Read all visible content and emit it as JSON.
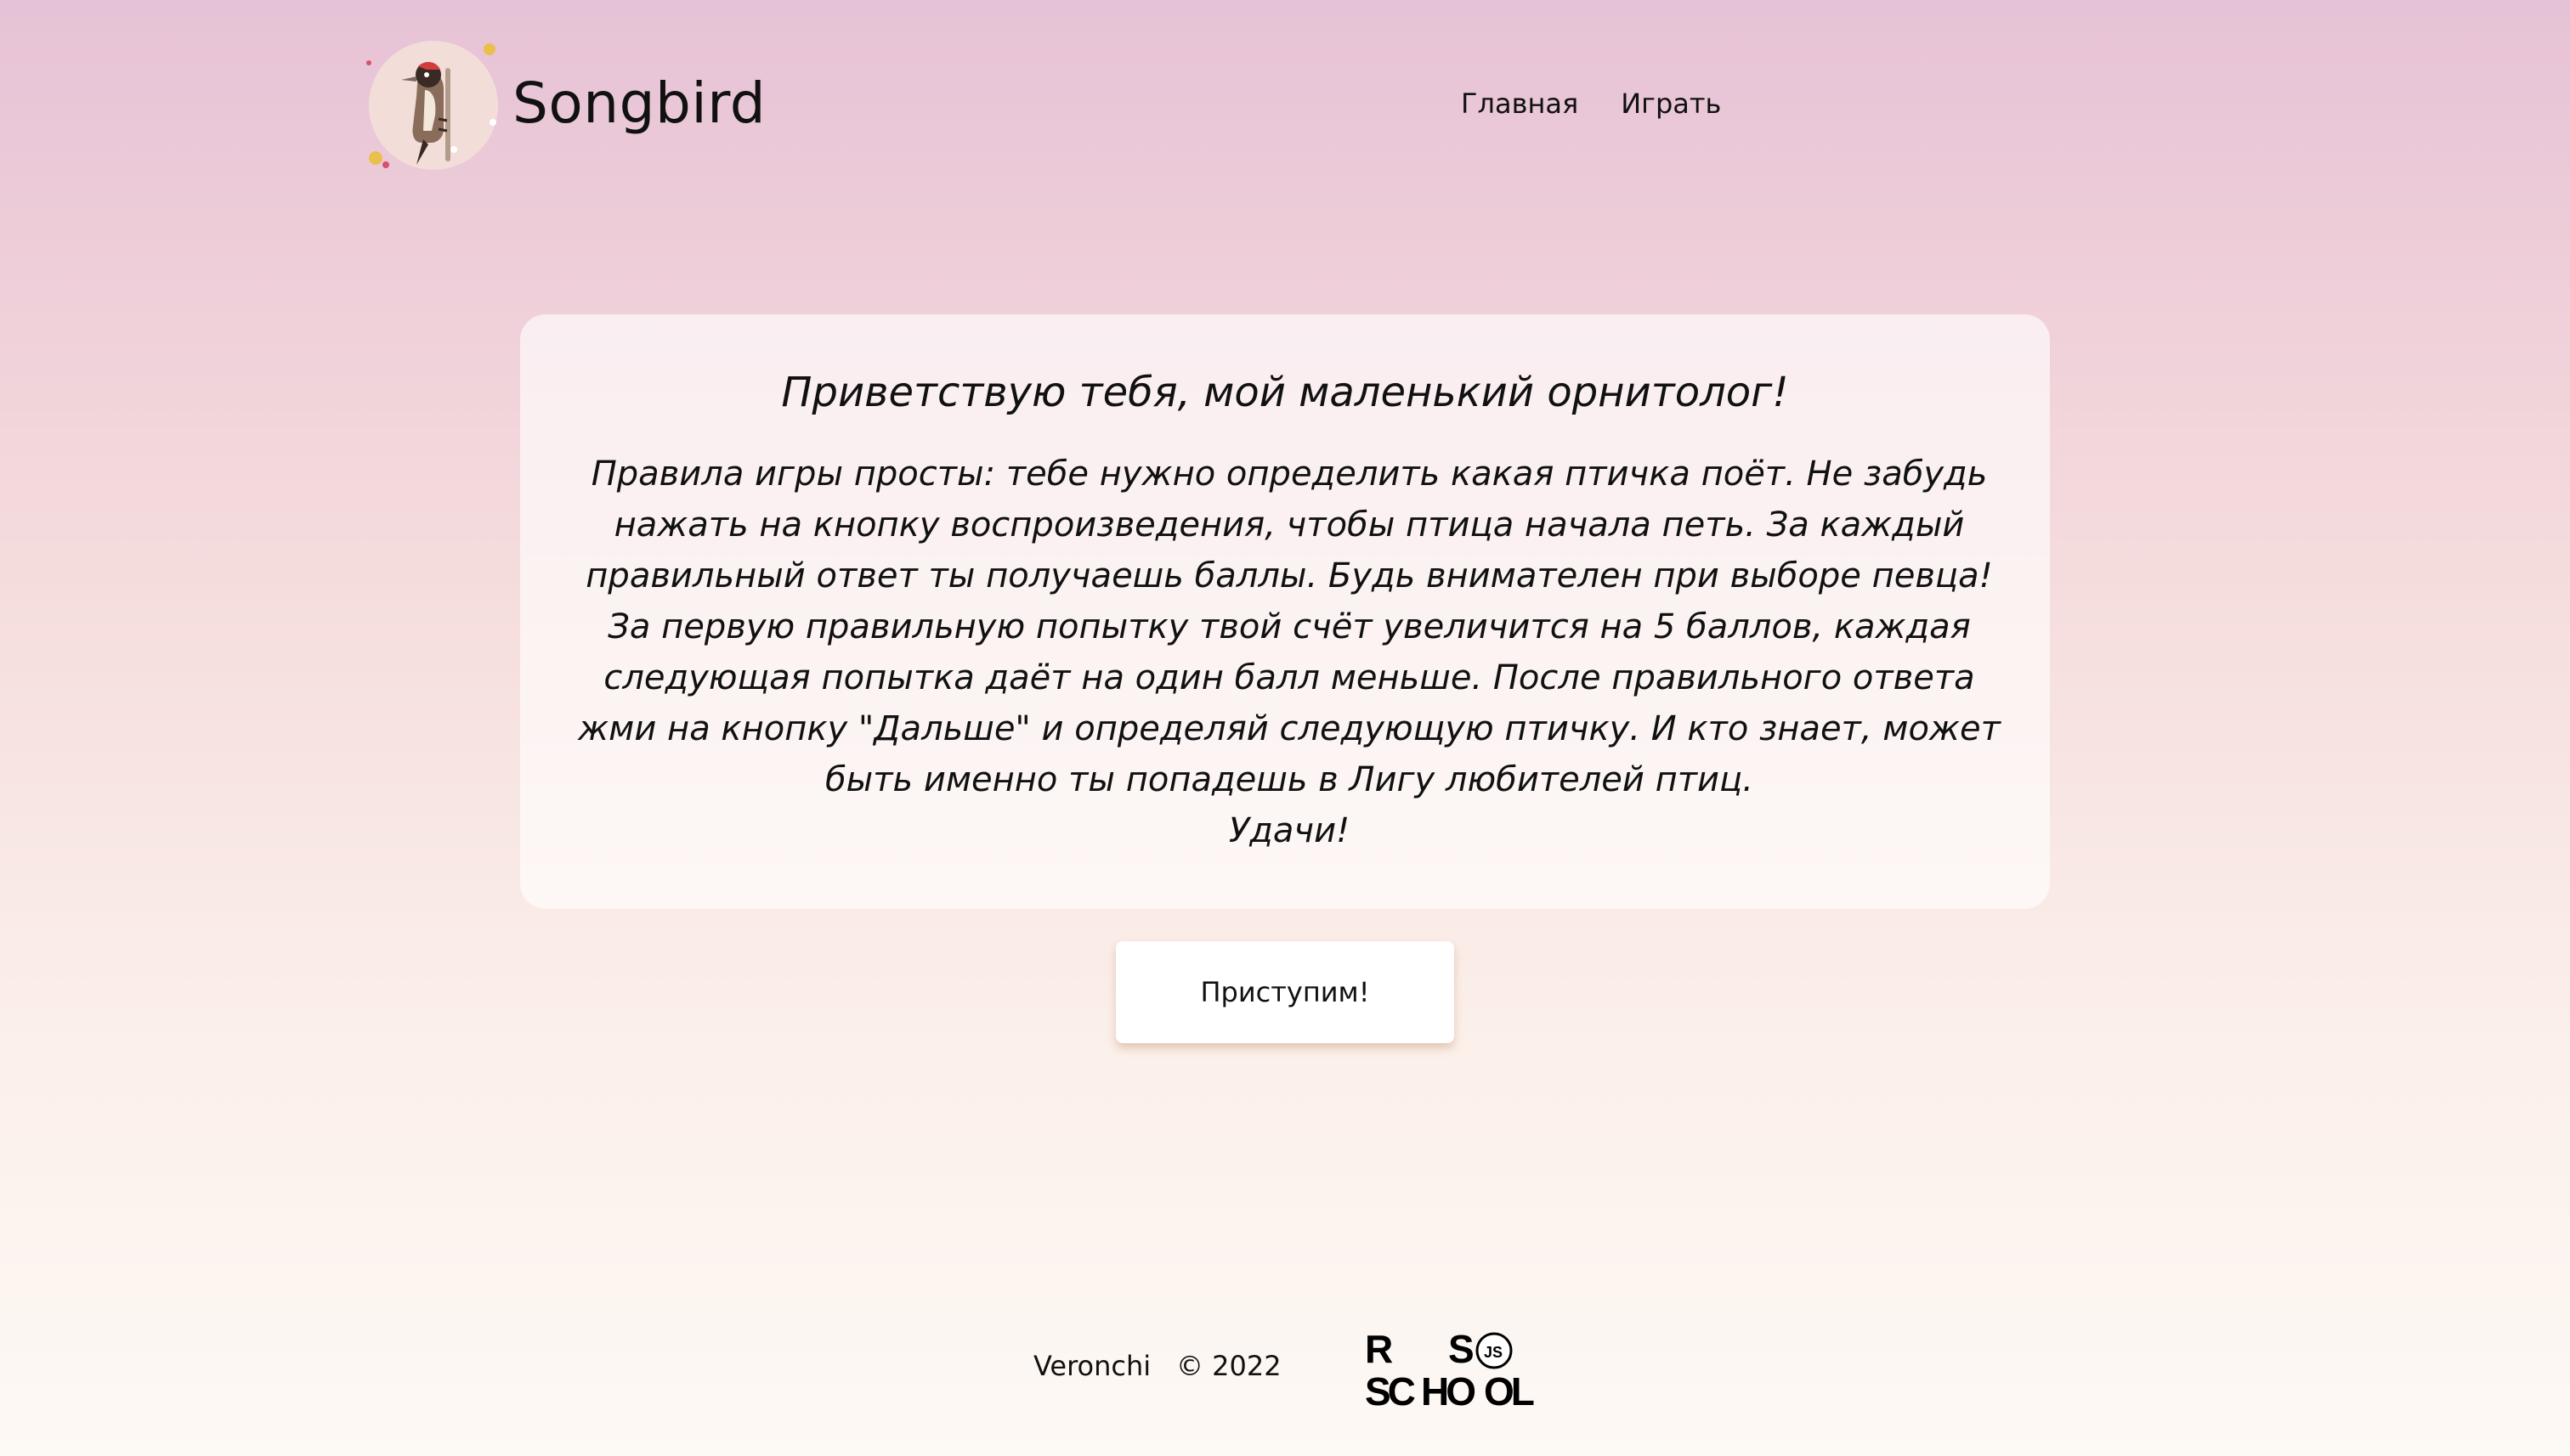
{
  "header": {
    "brand": "Songbird",
    "logo_icon": "woodpecker-icon",
    "nav": [
      {
        "label": "Главная"
      },
      {
        "label": "Играть"
      }
    ]
  },
  "welcome": {
    "title": "Приветствую тебя, мой маленький орнитолог!",
    "rules": "Правила игры просты: тебе нужно определить какая птичка поёт. Не забудь нажать на кнопку воспроизведения, чтобы птица начала петь. За каждый правильный ответ ты получаешь баллы. Будь внимателен при выборе певца! За первую правильную попытку твой счёт увеличится на 5 баллов, каждая следующая попытка даёт на один балл меньше. После правильного ответа жми на кнопку \"Дальше\" и определяй следующую птичку. И кто знает, может быть именно ты попадешь в Лигу любителей птиц.",
    "luck": "Удачи!"
  },
  "start_button": {
    "label": "Приступим!"
  },
  "footer": {
    "author": "Veronchi",
    "copyright": "© 2022",
    "school_logo": "rs-school-js-logo"
  },
  "colors": {
    "gradient_top": "#e6c2d6",
    "gradient_bottom": "#fdf9f5",
    "text": "#111111",
    "card_bg": "#ffffff"
  }
}
